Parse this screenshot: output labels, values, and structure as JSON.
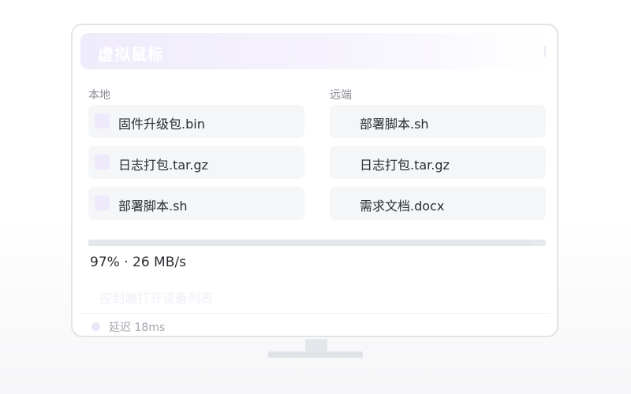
{
  "window": {
    "title": "虚拟鼠标"
  },
  "local": {
    "label": "本地",
    "files": [
      {
        "name": "固件升级包.bin"
      },
      {
        "name": "日志打包.tar.gz"
      },
      {
        "name": "部署脚本.sh"
      }
    ]
  },
  "remote": {
    "label": "远端",
    "files": [
      {
        "name": "部署脚本.sh"
      },
      {
        "name": "日志打包.tar.gz"
      },
      {
        "name": "需求文档.docx"
      }
    ]
  },
  "transfer": {
    "progress_percent": 97,
    "progress_text": "97% · 26 MB/s"
  },
  "hint": "控制端打开设备列表",
  "status": {
    "latency": "延迟 18ms"
  },
  "colors": {
    "accent_light": "#efeafb",
    "text_primary": "#2a2c31",
    "text_muted": "#8a8d96",
    "item_bg": "#f5f6f8"
  }
}
